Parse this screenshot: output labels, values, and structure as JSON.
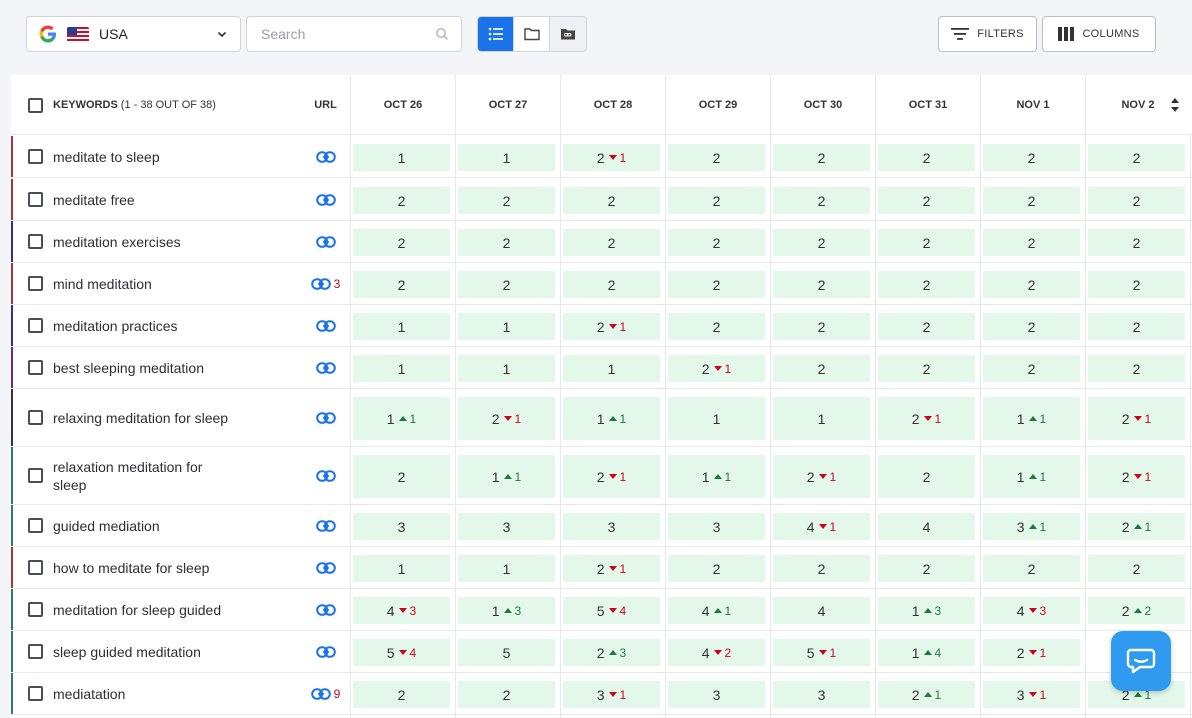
{
  "toolbar": {
    "country": "USA",
    "search_placeholder": "Search",
    "filters_label": "FILTERS",
    "columns_label": "COLUMNS"
  },
  "table": {
    "keywords_header": "KEYWORDS",
    "keywords_count": "(1 - 38 OUT OF 38)",
    "url_header": "URL",
    "dates": [
      "OCT 26",
      "OCT 27",
      "OCT 28",
      "OCT 29",
      "OCT 30",
      "OCT 31",
      "NOV 1",
      "NOV 2"
    ],
    "rows": [
      {
        "keyword": "meditate to sleep",
        "bar": "#a3363b",
        "url_count": "",
        "values": [
          [
            "1",
            "",
            ""
          ],
          [
            "1",
            "",
            ""
          ],
          [
            "2",
            "down",
            "1"
          ],
          [
            "2",
            "",
            ""
          ],
          [
            "2",
            "",
            ""
          ],
          [
            "2",
            "",
            ""
          ],
          [
            "2",
            "",
            ""
          ],
          [
            "2",
            "",
            ""
          ]
        ]
      },
      {
        "keyword": "meditate free",
        "bar": "#a3363b",
        "url_count": "",
        "values": [
          [
            "2",
            "",
            ""
          ],
          [
            "2",
            "",
            ""
          ],
          [
            "2",
            "",
            ""
          ],
          [
            "2",
            "",
            ""
          ],
          [
            "2",
            "",
            ""
          ],
          [
            "2",
            "",
            ""
          ],
          [
            "2",
            "",
            ""
          ],
          [
            "2",
            "",
            ""
          ]
        ]
      },
      {
        "keyword": "meditation exercises",
        "bar": "#3b2d8f",
        "url_count": "",
        "values": [
          [
            "2",
            "",
            ""
          ],
          [
            "2",
            "",
            ""
          ],
          [
            "2",
            "",
            ""
          ],
          [
            "2",
            "",
            ""
          ],
          [
            "2",
            "",
            ""
          ],
          [
            "2",
            "",
            ""
          ],
          [
            "2",
            "",
            ""
          ],
          [
            "2",
            "",
            ""
          ]
        ]
      },
      {
        "keyword": "mind meditation",
        "bar": "#a3363b",
        "url_count": "3",
        "values": [
          [
            "2",
            "",
            ""
          ],
          [
            "2",
            "",
            ""
          ],
          [
            "2",
            "",
            ""
          ],
          [
            "2",
            "",
            ""
          ],
          [
            "2",
            "",
            ""
          ],
          [
            "2",
            "",
            ""
          ],
          [
            "2",
            "",
            ""
          ],
          [
            "2",
            "",
            ""
          ]
        ]
      },
      {
        "keyword": "meditation practices",
        "bar": "#3b2d8f",
        "url_count": "",
        "values": [
          [
            "1",
            "",
            ""
          ],
          [
            "1",
            "",
            ""
          ],
          [
            "2",
            "down",
            "1"
          ],
          [
            "2",
            "",
            ""
          ],
          [
            "2",
            "",
            ""
          ],
          [
            "2",
            "",
            ""
          ],
          [
            "2",
            "",
            ""
          ],
          [
            "2",
            "",
            ""
          ]
        ]
      },
      {
        "keyword": "best sleeping meditation",
        "bar": "#6b2a8a",
        "url_count": "",
        "values": [
          [
            "1",
            "",
            ""
          ],
          [
            "1",
            "",
            ""
          ],
          [
            "1",
            "",
            ""
          ],
          [
            "2",
            "down",
            "1"
          ],
          [
            "2",
            "",
            ""
          ],
          [
            "2",
            "",
            ""
          ],
          [
            "2",
            "",
            ""
          ],
          [
            "2",
            "",
            ""
          ]
        ]
      },
      {
        "keyword": "relaxing meditation for sleep",
        "bar": "#333333",
        "url_count": "",
        "values": [
          [
            "1",
            "up",
            "1"
          ],
          [
            "2",
            "down",
            "1"
          ],
          [
            "1",
            "up",
            "1"
          ],
          [
            "1",
            "",
            ""
          ],
          [
            "1",
            "",
            ""
          ],
          [
            "2",
            "down",
            "1"
          ],
          [
            "1",
            "up",
            "1"
          ],
          [
            "2",
            "down",
            "1"
          ]
        ]
      },
      {
        "keyword": "relaxation meditation for sleep",
        "bar": "#2e7d5b",
        "url_count": "",
        "values": [
          [
            "2",
            "",
            ""
          ],
          [
            "1",
            "up",
            "1"
          ],
          [
            "2",
            "down",
            "1"
          ],
          [
            "1",
            "up",
            "1"
          ],
          [
            "2",
            "down",
            "1"
          ],
          [
            "2",
            "",
            ""
          ],
          [
            "1",
            "up",
            "1"
          ],
          [
            "2",
            "down",
            "1"
          ]
        ]
      },
      {
        "keyword": "guided mediation",
        "bar": "#2e7d5b",
        "url_count": "",
        "values": [
          [
            "3",
            "",
            ""
          ],
          [
            "3",
            "",
            ""
          ],
          [
            "3",
            "",
            ""
          ],
          [
            "3",
            "",
            ""
          ],
          [
            "4",
            "down",
            "1"
          ],
          [
            "4",
            "",
            ""
          ],
          [
            "3",
            "up",
            "1"
          ],
          [
            "2",
            "up",
            "1"
          ]
        ]
      },
      {
        "keyword": "how to meditate for sleep",
        "bar": "#a3363b",
        "url_count": "",
        "values": [
          [
            "1",
            "",
            ""
          ],
          [
            "1",
            "",
            ""
          ],
          [
            "2",
            "down",
            "1"
          ],
          [
            "2",
            "",
            ""
          ],
          [
            "2",
            "",
            ""
          ],
          [
            "2",
            "",
            ""
          ],
          [
            "2",
            "",
            ""
          ],
          [
            "2",
            "",
            ""
          ]
        ]
      },
      {
        "keyword": "meditation for sleep guided",
        "bar": "#2e7d5b",
        "url_count": "",
        "values": [
          [
            "4",
            "down",
            "3"
          ],
          [
            "1",
            "up",
            "3"
          ],
          [
            "5",
            "down",
            "4"
          ],
          [
            "4",
            "up",
            "1"
          ],
          [
            "4",
            "",
            ""
          ],
          [
            "1",
            "up",
            "3"
          ],
          [
            "4",
            "down",
            "3"
          ],
          [
            "2",
            "up",
            "2"
          ]
        ]
      },
      {
        "keyword": "sleep guided meditation",
        "bar": "#2e7d5b",
        "url_count": "",
        "values": [
          [
            "5",
            "down",
            "4"
          ],
          [
            "5",
            "",
            ""
          ],
          [
            "2",
            "up",
            "3"
          ],
          [
            "4",
            "down",
            "2"
          ],
          [
            "5",
            "down",
            "1"
          ],
          [
            "1",
            "up",
            "4"
          ],
          [
            "2",
            "down",
            "1"
          ],
          [
            "",
            "",
            ""
          ]
        ]
      },
      {
        "keyword": "mediatation",
        "bar": "#2e7d5b",
        "url_count": "9",
        "values": [
          [
            "2",
            "",
            ""
          ],
          [
            "2",
            "",
            ""
          ],
          [
            "3",
            "down",
            "1"
          ],
          [
            "3",
            "",
            ""
          ],
          [
            "3",
            "",
            ""
          ],
          [
            "2",
            "up",
            "1"
          ],
          [
            "3",
            "down",
            "1"
          ],
          [
            "2",
            "up",
            "1"
          ]
        ]
      }
    ]
  },
  "icons": {
    "google": "google-g-icon",
    "flag": "us-flag-icon",
    "list_view": "list-view-icon",
    "folder_view": "folder-icon",
    "link_folder": "link-folder-icon",
    "url": "link-icon",
    "filters": "filter-lines-icon",
    "columns": "columns-icon",
    "chat": "chat-bubble-icon"
  },
  "colors": {
    "accent": "#1a73e8",
    "cell_bg": "#e3f8eb",
    "down": "#d0021b",
    "up": "#1e7a36",
    "chat": "#2e9bf0"
  }
}
